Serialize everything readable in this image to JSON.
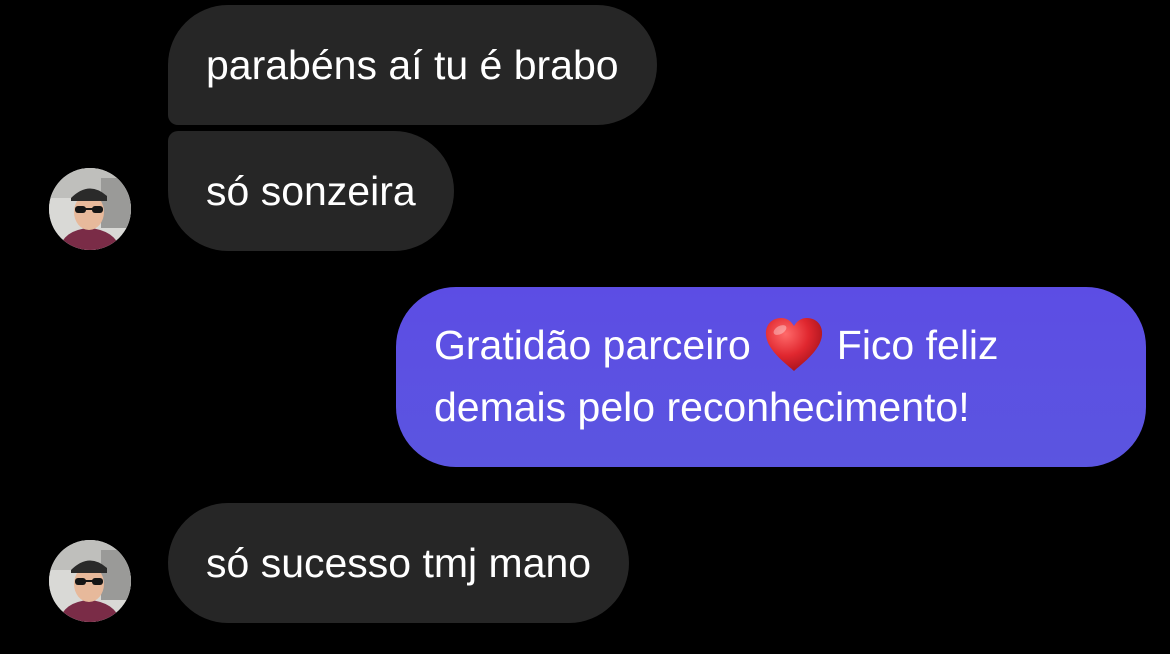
{
  "conversation": {
    "messages": [
      {
        "direction": "incoming",
        "text": "parabéns aí tu é brabo"
      },
      {
        "direction": "incoming",
        "text": "só sonzeira"
      },
      {
        "direction": "outgoing",
        "line1_before_emoji": "Gratidão parceiro",
        "emoji": "red-heart-icon",
        "line1_after_emoji": "Fico feliz",
        "line2": "demais pelo reconhecimento!"
      },
      {
        "direction": "incoming",
        "text": "só sucesso tmj mano"
      }
    ]
  },
  "colors": {
    "background": "#000000",
    "incoming_bubble": "#262626",
    "outgoing_bubble": "#5b4fe3",
    "text": "#ffffff",
    "heart": "#e0272f"
  },
  "icons": {
    "sender_avatar": "profile-photo-avatar"
  }
}
